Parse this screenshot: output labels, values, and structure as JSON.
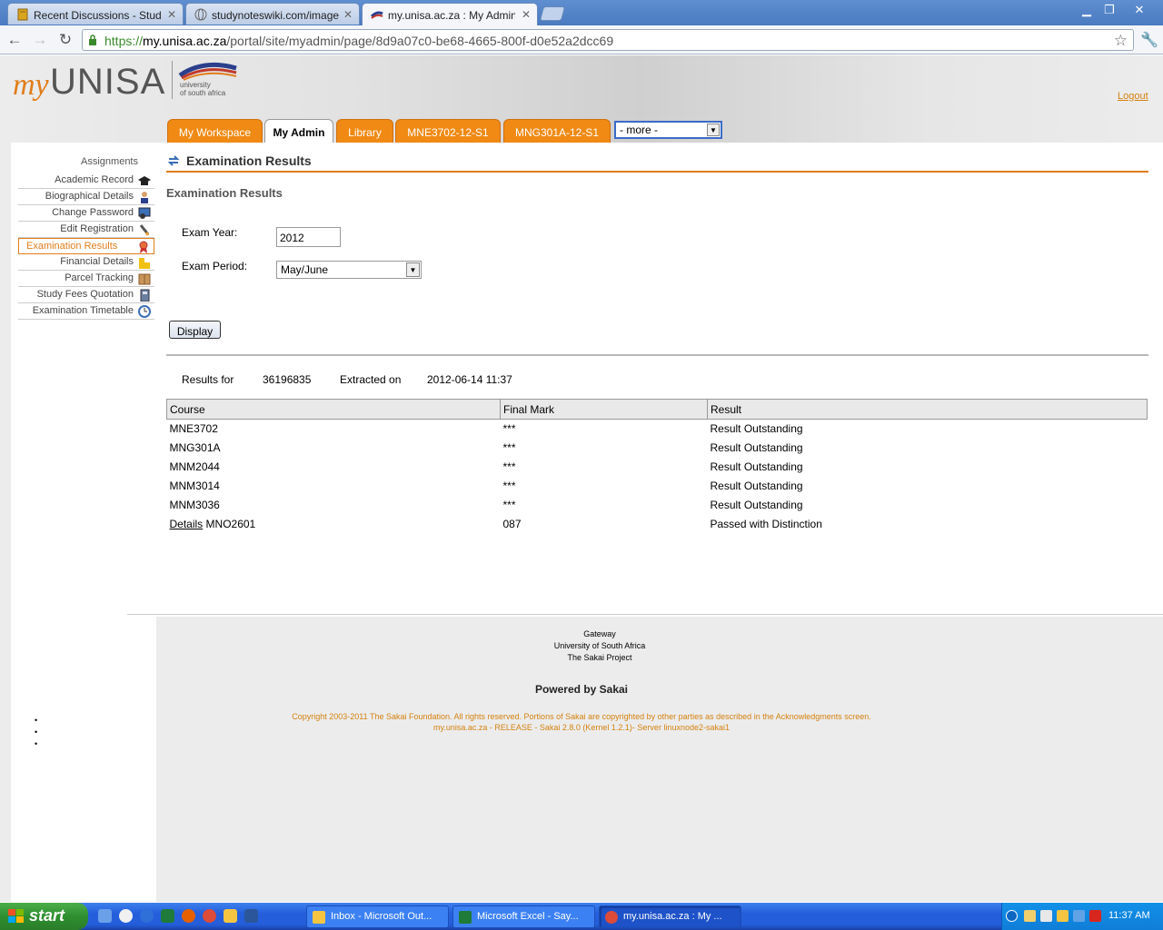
{
  "browser": {
    "tabs": [
      {
        "title": "Recent Discussions - StudyNot",
        "active": false
      },
      {
        "title": "studynoteswiki.com/images/fb",
        "active": false
      },
      {
        "title": "my.unisa.ac.za : My Admin : E",
        "active": true
      }
    ],
    "url_scheme": "https://",
    "url_host": "my.unisa.ac.za",
    "url_path": "/portal/site/myadmin/page/8d9a07c0-be68-4665-800f-d0e52a2dcc69"
  },
  "header": {
    "logo_my": "my",
    "logo_unisa": "UNISA",
    "logo_sub_line1": "university",
    "logo_sub_line2": "of south africa",
    "logout": "Logout"
  },
  "site_tabs": [
    {
      "label": "My Workspace"
    },
    {
      "label": "My Admin"
    },
    {
      "label": "Library"
    },
    {
      "label": "MNE3702-12-S1"
    },
    {
      "label": "MNG301A-12-S1"
    }
  ],
  "more_select": {
    "value": "- more -"
  },
  "sidebar": {
    "heading": "Assignments",
    "items": [
      {
        "label": "Academic Record",
        "icon": "graduation-cap-icon"
      },
      {
        "label": "Biographical Details",
        "icon": "person-icon"
      },
      {
        "label": "Change Password",
        "icon": "computer-user-icon"
      },
      {
        "label": "Edit Registration",
        "icon": "pencil-icon"
      },
      {
        "label": "Examination Results",
        "icon": "award-ribbon-icon",
        "selected": true
      },
      {
        "label": "Financial Details",
        "icon": "coins-icon"
      },
      {
        "label": "Parcel Tracking",
        "icon": "parcel-icon"
      },
      {
        "label": "Study Fees Quotation",
        "icon": "calculator-icon"
      },
      {
        "label": "Examination Timetable",
        "icon": "clock-icon"
      }
    ]
  },
  "content": {
    "tool_title": "Examination Results",
    "page_heading": "Examination Results",
    "exam_year_label": "Exam Year:",
    "exam_year_value": "2012",
    "exam_period_label": "Exam Period:",
    "exam_period_value": "May/June",
    "display_button": "Display",
    "results_for_label": "Results for",
    "student_number": "36196835",
    "extracted_label": "Extracted on",
    "extracted_date": "2012-06-14 11:37",
    "table": {
      "headers": [
        "Course",
        "Final Mark",
        "Result"
      ],
      "rows": [
        {
          "link": "",
          "course": "MNE3702",
          "mark": "***",
          "result": "Result Outstanding"
        },
        {
          "link": "",
          "course": "MNG301A",
          "mark": "***",
          "result": "Result Outstanding"
        },
        {
          "link": "",
          "course": "MNM2044",
          "mark": "***",
          "result": "Result Outstanding"
        },
        {
          "link": "",
          "course": "MNM3014",
          "mark": "***",
          "result": "Result Outstanding"
        },
        {
          "link": "",
          "course": "MNM3036",
          "mark": "***",
          "result": "Result Outstanding"
        },
        {
          "link": "Details",
          "course": "MNO2601",
          "mark": "087",
          "result": "Passed with Distinction"
        }
      ]
    }
  },
  "footer": {
    "links": [
      "Gateway",
      "University of South Africa",
      "The Sakai Project"
    ],
    "powered": "Powered by Sakai",
    "copyright": "Copyright 2003-2011 The Sakai Foundation. All rights reserved. Portions of Sakai are copyrighted by other parties as described in the Acknowledgments screen.",
    "release": "my.unisa.ac.za - RELEASE - Sakai 2.8.0 (Kernel 1.2.1)- Server linuxnode2-sakai1"
  },
  "taskbar": {
    "start": "start",
    "tasks": [
      {
        "label": "Inbox - Microsoft Out...",
        "icon": "outlook-icon"
      },
      {
        "label": "Microsoft Excel - Say...",
        "icon": "excel-icon"
      },
      {
        "label": "my.unisa.ac.za : My ...",
        "icon": "chrome-icon",
        "active": true
      }
    ],
    "clock": "11:37 AM"
  },
  "colors": {
    "accent_orange": "#f08a14",
    "link_orange": "#d4820f",
    "xp_blue": "#245edb",
    "start_green": "#2f8f2f"
  }
}
